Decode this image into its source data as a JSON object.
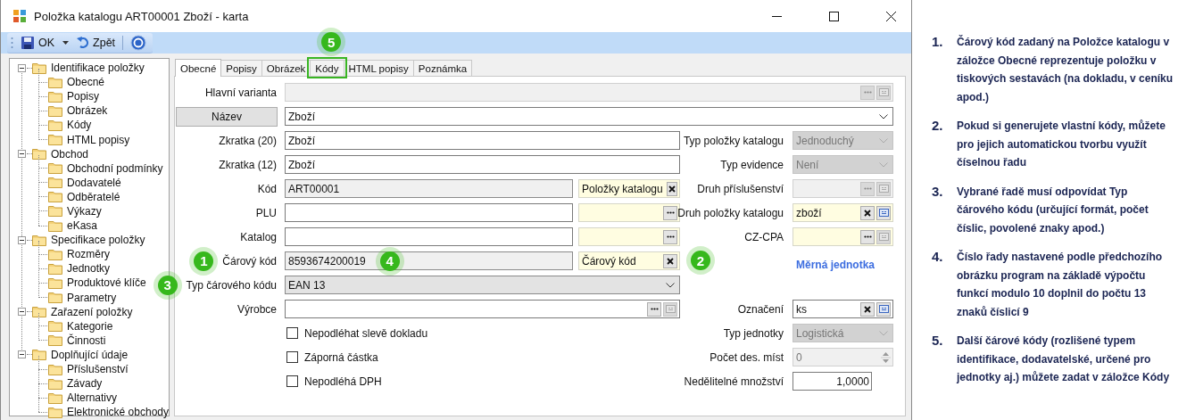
{
  "window": {
    "title": "Položka katalogu ART00001 Zboží - karta"
  },
  "toolbar": [
    {
      "kind": "save",
      "label": "OK"
    },
    {
      "kind": "dropdown"
    },
    {
      "kind": "undo",
      "label": "Zpět"
    },
    {
      "kind": "help"
    }
  ],
  "tree": [
    {
      "label": "Identifikace položky",
      "expanded": true,
      "children": [
        {
          "label": "Obecné"
        },
        {
          "label": "Popisy"
        },
        {
          "label": "Obrázek"
        },
        {
          "label": "Kódy"
        },
        {
          "label": "HTML popisy"
        }
      ]
    },
    {
      "label": "Obchod",
      "expanded": true,
      "children": [
        {
          "label": "Obchodní podmínky"
        },
        {
          "label": "Dodavatelé"
        },
        {
          "label": "Odběratelé"
        },
        {
          "label": "Výkazy"
        },
        {
          "label": "eKasa"
        }
      ]
    },
    {
      "label": "Specifikace položky",
      "expanded": true,
      "children": [
        {
          "label": "Rozměry"
        },
        {
          "label": "Jednotky"
        },
        {
          "label": "Produktové klíče"
        },
        {
          "label": "Parametry"
        }
      ]
    },
    {
      "label": "Zařazení položky",
      "expanded": true,
      "children": [
        {
          "label": "Kategorie"
        },
        {
          "label": "Činnosti"
        }
      ]
    },
    {
      "label": "Doplňující údaje",
      "expanded": true,
      "children": [
        {
          "label": "Příslušenství"
        },
        {
          "label": "Závady"
        },
        {
          "label": "Alternativy"
        },
        {
          "label": "Elektronické obchody"
        }
      ]
    }
  ],
  "tabs": [
    {
      "label": "Obecné",
      "selected": true,
      "highlighted": false
    },
    {
      "label": "Popisy",
      "selected": false,
      "highlighted": false
    },
    {
      "label": "Obrázek",
      "selected": false,
      "highlighted": false
    },
    {
      "label": "Kódy",
      "selected": false,
      "highlighted": true,
      "badge": "5"
    },
    {
      "label": "HTML popisy",
      "selected": false,
      "highlighted": false
    },
    {
      "label": "Poznámka",
      "selected": false,
      "highlighted": false
    }
  ],
  "form": {
    "header_rows": [
      {
        "label": {
          "text": "Hlavní varianta"
        },
        "field": {
          "kind": "picker",
          "disabled": true,
          "buttons": [
            {
              "kind": "more",
              "disabled": true
            },
            {
              "kind": "card",
              "disabled": true
            }
          ]
        }
      },
      {
        "label": {
          "text": "Název",
          "kind": "button"
        },
        "field": {
          "kind": "combo",
          "value": "Zboží"
        }
      }
    ],
    "rows": [
      {
        "left": {
          "label": {
            "text": "Zkratka (20)"
          },
          "field": {
            "kind": "text",
            "value": "Zboží"
          }
        },
        "right": {
          "label": {
            "text": "Typ položky katalogu"
          },
          "field": {
            "kind": "combo",
            "value": "Jednoduchý",
            "disabled": true
          }
        }
      },
      {
        "left": {
          "label": {
            "text": "Zkratka (12)"
          },
          "field": {
            "kind": "text",
            "value": "Zboží"
          }
        },
        "right": {
          "label": {
            "text": "Typ evidence"
          },
          "field": {
            "kind": "combo",
            "value": "Není",
            "disabled": true
          }
        }
      },
      {
        "left": {
          "label": {
            "text": "Kód"
          },
          "field": {
            "kind": "text",
            "value": "ART00001",
            "readonly": true
          },
          "lookup": {
            "kind": "lookup",
            "value": "Položky katalogu",
            "buttons": [
              {
                "kind": "clear"
              }
            ]
          }
        },
        "right": {
          "label": {
            "text": "Druh příslušenství"
          },
          "field": {
            "kind": "picker",
            "disabled": true,
            "buttons": [
              {
                "kind": "more",
                "disabled": true
              },
              {
                "kind": "card",
                "disabled": true
              }
            ]
          }
        }
      },
      {
        "left": {
          "label": {
            "text": "PLU"
          },
          "field": {
            "kind": "text"
          },
          "lookup": {
            "kind": "lookup",
            "buttons": [
              {
                "kind": "more"
              }
            ]
          }
        },
        "right": {
          "label": {
            "text": "Druh položky katalogu"
          },
          "field": {
            "kind": "lookup",
            "value": "zboží",
            "buttons": [
              {
                "kind": "clear"
              },
              {
                "kind": "card"
              }
            ]
          }
        }
      },
      {
        "left": {
          "label": {
            "text": "Katalog"
          },
          "field": {
            "kind": "text"
          },
          "lookup": {
            "kind": "lookup",
            "buttons": [
              {
                "kind": "more"
              }
            ]
          }
        },
        "right": {
          "label": {
            "text": "CZ-CPA"
          },
          "field": {
            "kind": "lookup",
            "buttons": [
              {
                "kind": "more"
              },
              {
                "kind": "card",
                "disabled": true
              }
            ]
          }
        }
      },
      {
        "left": {
          "label": {
            "text": "Čárový kód",
            "badge": "1"
          },
          "field": {
            "kind": "text",
            "value": "8593674200019",
            "readonly": true,
            "badge": "4"
          },
          "lookup": {
            "kind": "lookup",
            "value": "Čárový kód",
            "buttons": [
              {
                "kind": "clear"
              }
            ],
            "badge": "2"
          }
        },
        "right": {
          "field": {
            "kind": "link",
            "value": "Měrná jednotka"
          }
        }
      },
      {
        "left": {
          "label": {
            "text": "Typ čárového kódu",
            "badge": "3"
          },
          "field": {
            "kind": "combo",
            "value": "EAN 13",
            "readonly": true
          }
        }
      },
      {
        "left": {
          "label": {
            "text": "Výrobce"
          },
          "field": {
            "kind": "picker",
            "buttons": [
              {
                "kind": "more"
              },
              {
                "kind": "card",
                "disabled": true
              }
            ]
          }
        },
        "right": {
          "label": {
            "text": "Označení"
          },
          "field": {
            "kind": "picker",
            "value": "ks",
            "buttons": [
              {
                "kind": "clear"
              },
              {
                "kind": "card"
              }
            ]
          }
        }
      },
      {
        "left": {
          "field": {
            "kind": "checkbox",
            "label": "Nepodléhat slevě dokladu",
            "checked": false
          }
        },
        "right": {
          "label": {
            "text": "Typ jednotky"
          },
          "field": {
            "kind": "combo",
            "value": "Logistická",
            "disabled": true
          }
        }
      },
      {
        "left": {
          "field": {
            "kind": "checkbox",
            "label": "Záporná částka",
            "checked": false
          }
        },
        "right": {
          "label": {
            "text": "Počet des. míst"
          },
          "field": {
            "kind": "spin",
            "value": "0",
            "disabled": true
          }
        }
      },
      {
        "left": {
          "field": {
            "kind": "checkbox",
            "label": "Nepodléhá DPH",
            "checked": false
          }
        },
        "right": {
          "label": {
            "text": "Nedělitelné množství"
          },
          "field": {
            "kind": "number",
            "value": "1,0000"
          }
        }
      }
    ]
  },
  "notes": [
    {
      "number": "1.",
      "text": "Čárový kód zadaný na Položce katalogu v záložce Obecné reprezentuje položku v tiskových sestavách (na dokladu, v ceníku apod.)"
    },
    {
      "number": "2.",
      "text": "Pokud si generujete vlastní kódy, můžete pro jejich automatickou tvorbu využít číselnou řadu"
    },
    {
      "number": "3.",
      "text": "Vybrané řadě musí odpovídat Typ čárového kódu (určující formát, počet číslic, povolené znaky apod.)"
    },
    {
      "number": "4.",
      "text": "Číslo řady nastavené podle předchozího obrázku program na základě výpočtu funkcí modulo 10 doplnil do počtu 13 znaků číslicí 9"
    },
    {
      "number": "5.",
      "text": "Další čárové kódy (rozlišené typem identifikace, dodavatelské, určené pro jednotky aj.) můžete zadat v záložce Kódy"
    }
  ]
}
